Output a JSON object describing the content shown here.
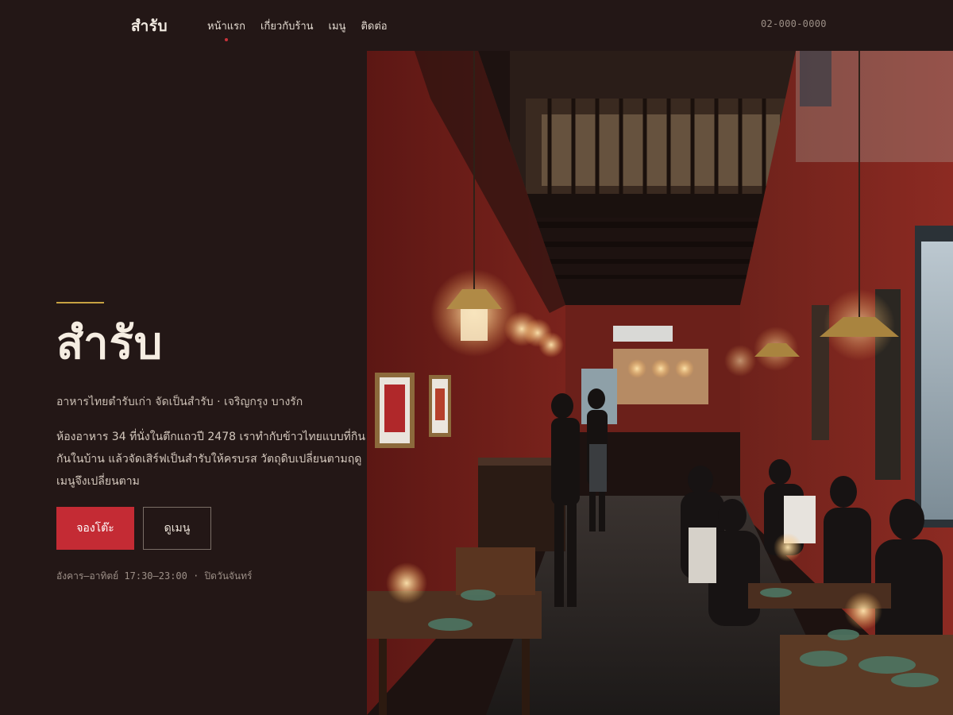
{
  "header": {
    "brand": "สำรับ",
    "nav": [
      {
        "label": "หน้าแรก",
        "active": true
      },
      {
        "label": "เกี่ยวกับร้าน",
        "active": false
      },
      {
        "label": "เมนู",
        "active": false
      },
      {
        "label": "ติดต่อ",
        "active": false
      }
    ],
    "phone": "02-000-0000"
  },
  "hero": {
    "title": "สำรับ",
    "subtitle": "อาหารไทยตำรับเก่า จัดเป็นสำรับ · เจริญกรุง บางรัก",
    "description": "ห้องอาหาร 34 ที่นั่งในตึกแถวปี 2478 เราทำกับข้าวไทยแบบที่กินกันในบ้าน แล้วจัดเสิร์ฟเป็นสำรับให้ครบรส วัตถุดิบเปลี่ยนตามฤดู เมนูจึงเปลี่ยนตาม",
    "primary_button": "จองโต๊ะ",
    "secondary_button": "ดูเมนู",
    "hours": "อังคาร–อาทิตย์ 17:30–23:00 · ปิดวันจันทร์"
  },
  "colors": {
    "background": "#231716",
    "accent_red": "#c42b34",
    "accent_gold": "#c7a242"
  }
}
